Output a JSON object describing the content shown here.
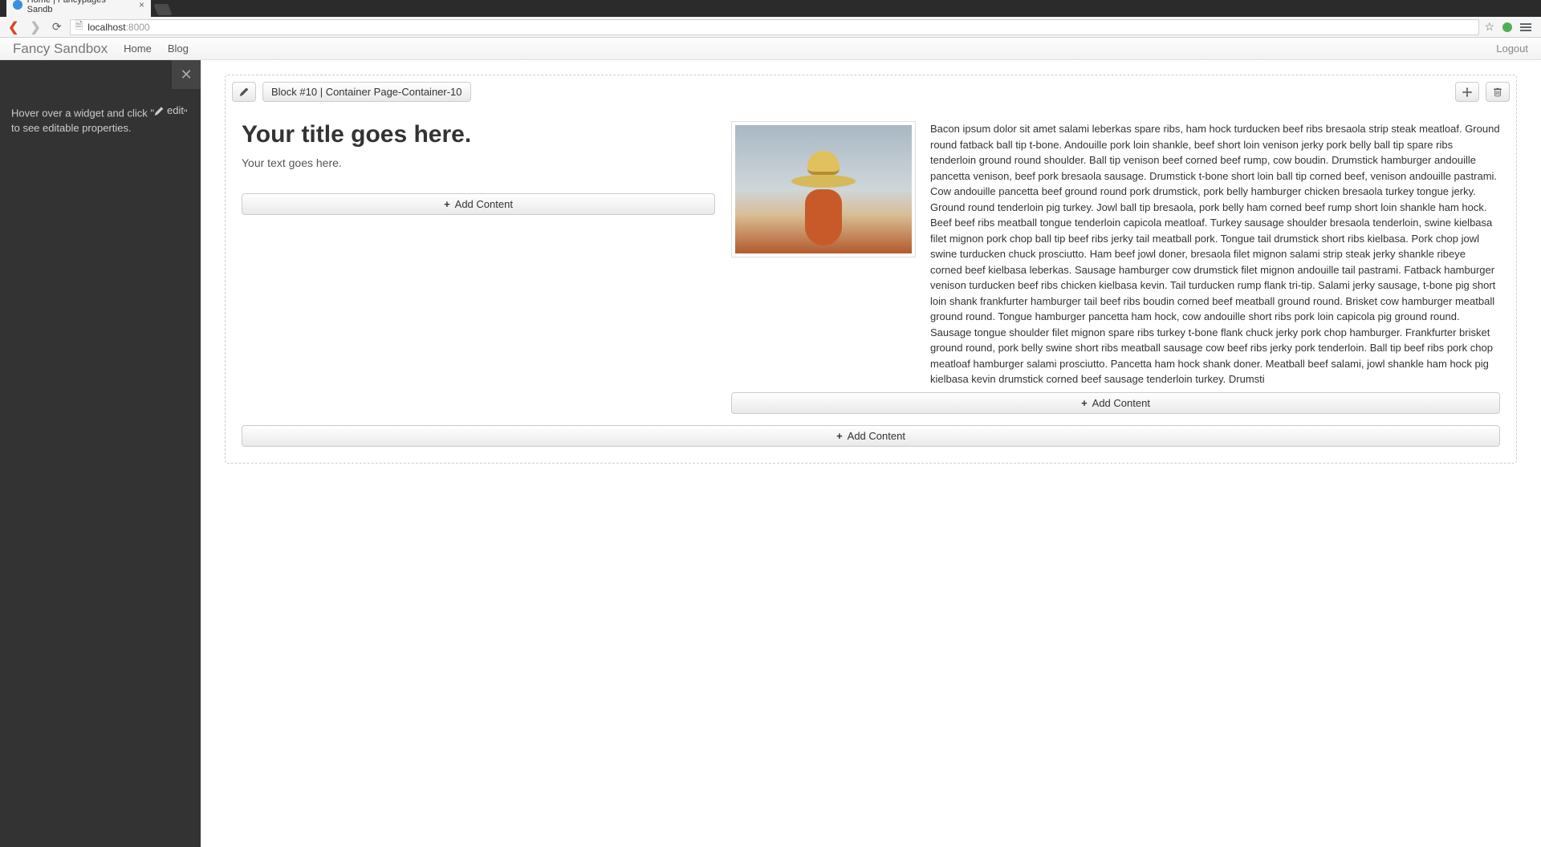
{
  "browser": {
    "tab_title": "Home | Fancypages Sandb",
    "url_host": "localhost",
    "url_port": ":8000"
  },
  "navbar": {
    "brand": "Fancy Sandbox",
    "home": "Home",
    "blog": "Blog",
    "logout": "Logout"
  },
  "sidebar": {
    "hint_pre": "Hover over a widget and click \"",
    "hint_edit": "edit",
    "hint_post": "\" to see editable properties."
  },
  "block": {
    "label": "Block #10 | Container Page-Container-10",
    "left": {
      "title": "Your title goes here.",
      "text": "Your text goes here.",
      "add_content": "Add Content"
    },
    "right": {
      "lipsum": "Bacon ipsum dolor sit amet salami leberkas spare ribs, ham hock turducken beef ribs bresaola strip steak meatloaf. Ground round fatback ball tip t-bone. Andouille pork loin shankle, beef short loin venison jerky pork belly ball tip spare ribs tenderloin ground round shoulder. Ball tip venison beef corned beef rump, cow boudin. Drumstick hamburger andouille pancetta venison, beef pork bresaola sausage. Drumstick t-bone short loin ball tip corned beef, venison andouille pastrami. Cow andouille pancetta beef ground round pork drumstick, pork belly hamburger chicken bresaola turkey tongue jerky. Ground round tenderloin pig turkey. Jowl ball tip bresaola, pork belly ham corned beef rump short loin shankle ham hock. Beef beef ribs meatball tongue tenderloin capicola meatloaf. Turkey sausage shoulder bresaola tenderloin, swine kielbasa filet mignon pork chop ball tip beef ribs jerky tail meatball pork. Tongue tail drumstick short ribs kielbasa. Pork chop jowl swine turducken chuck prosciutto. Ham beef jowl doner, bresaola filet mignon salami strip steak jerky shankle ribeye corned beef kielbasa leberkas. Sausage hamburger cow drumstick filet mignon andouille tail pastrami. Fatback hamburger venison turducken beef ribs chicken kielbasa kevin. Tail turducken rump flank tri-tip. Salami jerky sausage, t-bone pig short loin shank frankfurter hamburger tail beef ribs boudin corned beef meatball ground round. Brisket cow hamburger meatball ground round. Tongue hamburger pancetta ham hock, cow andouille short ribs pork loin capicola pig ground round. Sausage tongue shoulder filet mignon spare ribs turkey t-bone flank chuck jerky pork chop hamburger. Frankfurter brisket ground round, pork belly swine short ribs meatball sausage cow beef ribs jerky pork tenderloin. Ball tip beef ribs pork chop meatloaf hamburger salami prosciutto. Pancetta ham hock shank doner. Meatball beef salami, jowl shankle ham hock pig kielbasa kevin drumstick corned beef sausage tenderloin turkey. Drumsti",
      "add_content": "Add Content"
    },
    "bottom_add_content": "Add Content"
  }
}
